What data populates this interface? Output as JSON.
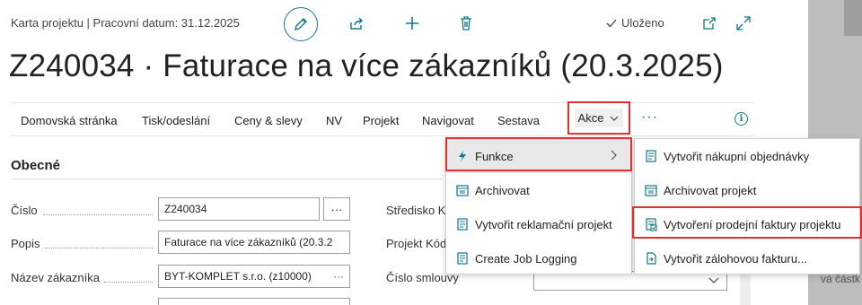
{
  "header": {
    "caption": "Karta projektu | Pracovní datum: 31.12.2025",
    "saved_label": "Uloženo",
    "title": "Z240034 · Faturace na více zákazníků (20.3.2025)"
  },
  "actionbar": {
    "items": [
      "Domovská stránka",
      "Tisk/odeslání",
      "Ceny & slevy",
      "NV",
      "Projekt",
      "Navigovat",
      "Sestava"
    ],
    "akce_label": "Akce",
    "more_label": "···",
    "info_label": "i"
  },
  "section": {
    "title": "Obecné"
  },
  "fields": {
    "cislo": {
      "label": "Číslo",
      "value": "Z240034",
      "lookup": "···"
    },
    "popis": {
      "label": "Popis",
      "value": "Faturace na více zákazníků (20.3.2"
    },
    "nazev": {
      "label": "Název zákazníka",
      "value": "BYT-KOMPLET s.r.o. (z10000)",
      "lookup": "···"
    }
  },
  "right_fields": {
    "stredisko": "Středisko K",
    "projekt_kod": "Projekt Kód",
    "cislo_smlouvy": "Číslo smlouvy"
  },
  "menu_akce": {
    "items": [
      "Funkce",
      "Archivovat",
      "Vytvořit reklamační projekt",
      "Create Job Logging"
    ]
  },
  "menu_funkce": {
    "items": [
      "Vytvořit nákupní objednávky",
      "Archivovat projekt",
      "Vytvoření prodejní faktury projektu",
      "Vytvořit zálohovou fakturu..."
    ]
  },
  "background_text": "vá částk",
  "colors": {
    "accent": "#0f7a8a",
    "highlight_border": "#e03030"
  }
}
